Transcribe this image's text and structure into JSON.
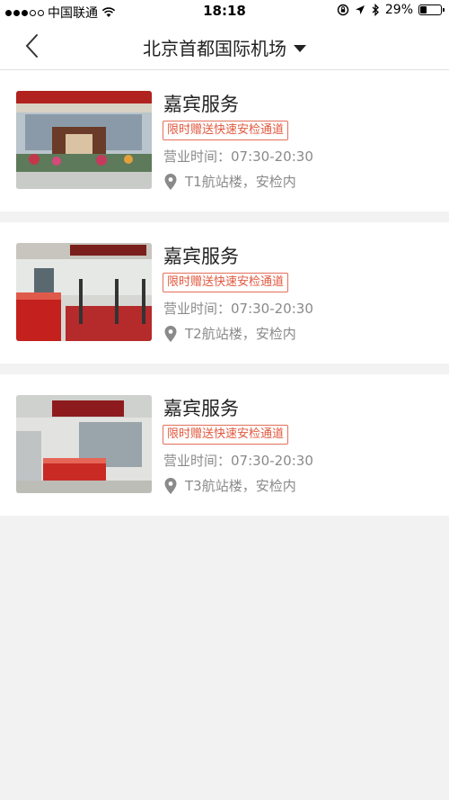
{
  "status_bar": {
    "carrier": "中国联通",
    "time": "18:18",
    "battery": "29%"
  },
  "nav": {
    "title": "北京首都国际机场"
  },
  "colors": {
    "badge": "#e2583e",
    "muted_text": "#8a8a8a",
    "background": "#f2f2f2"
  },
  "items": [
    {
      "title": "嘉宾服务",
      "badge": "限时赠送快速安检通道",
      "hours": "营业时间：07:30-20:30",
      "location": "T1航站楼，安检内"
    },
    {
      "title": "嘉宾服务",
      "badge": "限时赠送快速安检通道",
      "hours": "营业时间：07:30-20:30",
      "location": "T2航站楼，安检内"
    },
    {
      "title": "嘉宾服务",
      "badge": "限时赠送快速安检通道",
      "hours": "营业时间：07:30-20:30",
      "location": "T3航站楼，安检内"
    }
  ]
}
